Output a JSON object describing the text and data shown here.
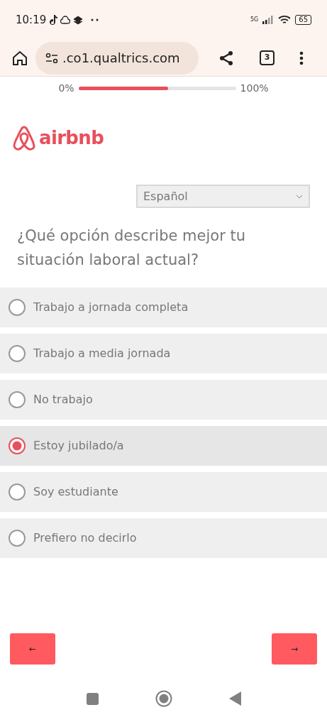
{
  "status_bar": {
    "time": "10:19",
    "network": "5G",
    "battery": "65"
  },
  "browser": {
    "url": ".co1.qualtrics.com",
    "tab_count": "3"
  },
  "progress": {
    "start_label": "0%",
    "end_label": "100%",
    "level": 0.57
  },
  "logo": {
    "text": "airbnb"
  },
  "language_select": {
    "value": "Español"
  },
  "question": "¿Qué opción describe mejor tu situación laboral actual?",
  "options": [
    {
      "label": "Trabajo a jornada completa",
      "selected": false
    },
    {
      "label": "Trabajo a media jornada",
      "selected": false
    },
    {
      "label": "No trabajo",
      "selected": false
    },
    {
      "label": "Estoy jubilado/a",
      "selected": true
    },
    {
      "label": "Soy estudiante",
      "selected": false
    },
    {
      "label": "Prefiero no decirlo",
      "selected": false
    }
  ],
  "buttons": {
    "back": "←",
    "next": "→"
  }
}
